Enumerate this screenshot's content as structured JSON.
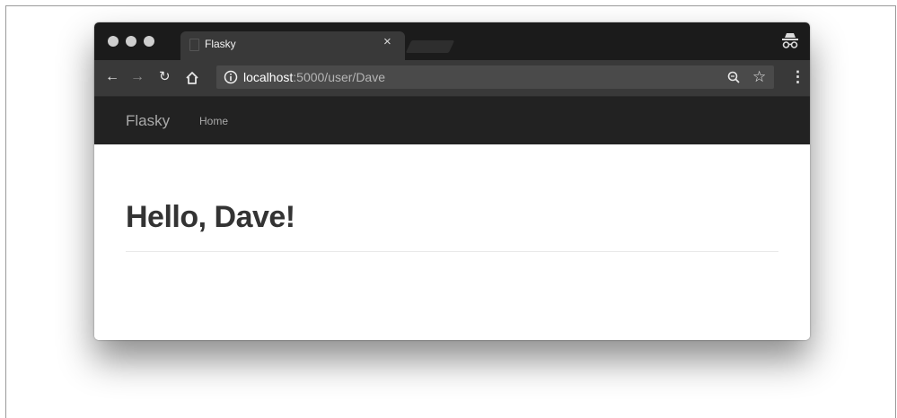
{
  "browser": {
    "tab": {
      "title": "Flasky"
    },
    "address_bar": {
      "host": "localhost",
      "path": ":5000/user/Dave"
    }
  },
  "navbar": {
    "brand": "Flasky",
    "links": [
      {
        "label": "Home"
      }
    ]
  },
  "page": {
    "heading": "Hello, Dave!"
  },
  "icons": {
    "back": "back-arrow-icon",
    "forward": "forward-arrow-icon",
    "reload": "reload-icon",
    "home": "home-icon",
    "info": "info-icon",
    "zoom": "zoom-icon",
    "bookmark": "star-icon",
    "menu": "kebab-menu-icon",
    "incognito": "incognito-icon"
  },
  "colors": {
    "titlebar": "#1b1b1b",
    "toolbar": "#393939",
    "navbar": "#222222",
    "heading": "#333333"
  }
}
